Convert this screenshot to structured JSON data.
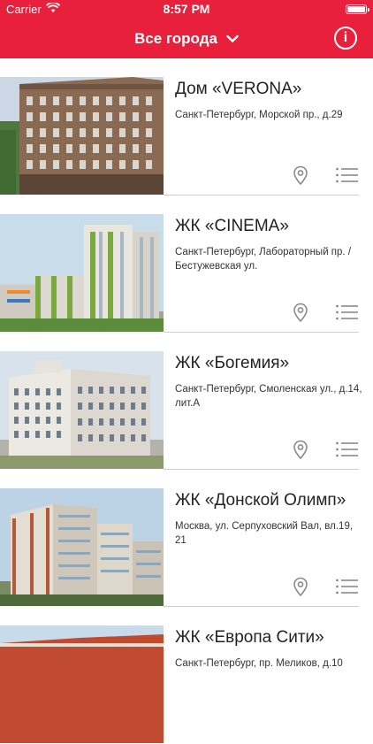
{
  "status_bar": {
    "carrier": "Carrier",
    "time": "8:57 PM"
  },
  "header": {
    "city_select_label": "Все города",
    "info_label": "i",
    "accent_color": "#e8203b"
  },
  "projects": [
    {
      "title": "Дом «VERONA»",
      "address": "Санкт-Петербург, Морской пр., д.29"
    },
    {
      "title": "ЖК «CINEMA»",
      "address": "Санкт-Петербург, Лабораторный пр. / Бестужевская ул."
    },
    {
      "title": "ЖК «Богемия»",
      "address": "Санкт-Петербург, Смоленская ул., д.14, лит.А"
    },
    {
      "title": "ЖК «Донской Олимп»",
      "address": "Москва, ул. Серпуховский Вал, вл.19, 21"
    },
    {
      "title": "ЖК «Европа Сити»",
      "address": "Санкт-Петербург, пр. Меликов, д.10"
    }
  ]
}
